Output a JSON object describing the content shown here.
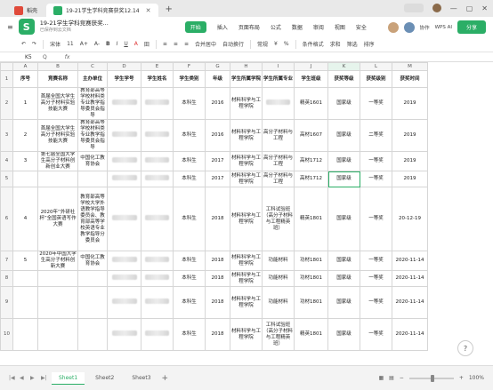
{
  "tabs": [
    {
      "label": "稻壳",
      "color": "#e04a3a"
    },
    {
      "label": "19-21学生学科竞赛获奖12.14",
      "color": "#2bae66"
    }
  ],
  "doc": {
    "name": "19-21学生学科竞赛获奖...",
    "saved": "已保存到云文档"
  },
  "menu": [
    "开始",
    "插入",
    "页面布局",
    "公式",
    "数据",
    "审阅",
    "视图",
    "安全",
    "开发工具",
    "特色功能"
  ],
  "menu_active": "开始",
  "right_tools": {
    "sync": "协作",
    "share": "分享",
    "wps_ai": "WPS AI"
  },
  "toolbar": [
    "宋体",
    "11",
    "A+",
    "A-",
    "B",
    "I",
    "U",
    "A",
    "田",
    "合并居中",
    "自动换行",
    "常规",
    "¥",
    "%",
    "条件格式",
    "求和",
    "筛选",
    "排序"
  ],
  "formula": {
    "cellref": "K5",
    "fx": "fx",
    "q": "Q"
  },
  "columns": [
    "A",
    "B",
    "C",
    "D",
    "E",
    "F",
    "G",
    "H",
    "I",
    "J",
    "K",
    "L",
    "M"
  ],
  "header_row": [
    "序号",
    "竞赛名称",
    "主办单位",
    "学生学号",
    "学生姓名",
    "学生类别",
    "年级",
    "学生所属学院",
    "学生所属专业",
    "学生班级",
    "获奖等级",
    "获奖级别",
    "获奖时间"
  ],
  "rows": [
    {
      "n": "2",
      "cells": [
        "1",
        "首届全国大学生高分子材料实验技能大赛",
        "教育部高等学校材料类专业教学指导委员会指导",
        "",
        "",
        "本科生",
        "2016",
        "材料科学与工程学院",
        "",
        "精英1601",
        "国家级",
        "一等奖",
        "2019"
      ],
      "blur": [
        3,
        4,
        8
      ]
    },
    {
      "n": "3",
      "cells": [
        "2",
        "首届全国大学生高分子材料实验技能大赛",
        "教育部高等学校材料类专业教学指导委员会指导",
        "",
        "",
        "本科生",
        "2016",
        "材料科学与工程学院",
        "高分子材料与工程",
        "高材1607",
        "国家级",
        "二等奖",
        "2019"
      ],
      "blur": [
        3,
        4
      ]
    },
    {
      "n": "4",
      "cells": [
        "3",
        "第七届全国大学生高分子材料创新创业大赛",
        "中国化工教育协会",
        "",
        "",
        "本科生",
        "2017",
        "材料科学与工程学院",
        "高分子材料与工程",
        "高材1712",
        "国家级",
        "一等奖",
        "2019"
      ],
      "blur": [
        3,
        4
      ]
    },
    {
      "n": "5",
      "cells": [
        "",
        "",
        "",
        "",
        "",
        "本科生",
        "2017",
        "材料科学与工程学院",
        "高分子材料与工程",
        "高材1712",
        "国家级",
        "一等奖",
        "2019"
      ],
      "blur": [
        3,
        4
      ]
    },
    {
      "n": "6",
      "cells": [
        "4",
        "2020年“外研社杯”全国英语写作大赛",
        "教育部高等学校大学外语教学指导委员会、教育部高等学校英语专业教学指导分委员会",
        "",
        "",
        "本科生",
        "2018",
        "材料科学与工程学院",
        "工科试验班（高分子材料与工程精英班）",
        "精英1801",
        "国家级",
        "一等奖",
        "20-12-19"
      ],
      "blur": [
        3,
        4
      ]
    },
    {
      "n": "7",
      "cells": [
        "5",
        "2020年中国大学生高分子材料创新大赛",
        "中国化工教育协会",
        "",
        "",
        "本科生",
        "2018",
        "材料科学与工程学院",
        "功能材料",
        "功材1801",
        "国家级",
        "一等奖",
        "2020-11-14"
      ],
      "blur": [
        3,
        4
      ]
    },
    {
      "n": "8",
      "cells": [
        "",
        "",
        "",
        "",
        "",
        "本科生",
        "2018",
        "材料科学与工程学院",
        "功能材料",
        "功材1801",
        "国家级",
        "一等奖",
        "2020-11-14"
      ],
      "blur": [
        3,
        4
      ]
    },
    {
      "n": "9",
      "cells": [
        "",
        "",
        "",
        "",
        "",
        "本科生",
        "2018",
        "材料科学与工程学院",
        "功能材料",
        "功材1801",
        "国家级",
        "一等奖",
        "2020-11-14"
      ],
      "blur": [
        3,
        4
      ]
    },
    {
      "n": "10",
      "cells": [
        "",
        "",
        "",
        "",
        "",
        "本科生",
        "2018",
        "材料科学与工程学院",
        "工科试验班（高分子材料与工程精英班）",
        "精英1801",
        "国家级",
        "一等奖",
        "2020-11-14"
      ],
      "blur": [
        3,
        4
      ]
    }
  ],
  "sheets": [
    "Sheet1",
    "Sheet2",
    "Sheet3"
  ],
  "active_sheet": "Sheet1",
  "zoom": "100%"
}
